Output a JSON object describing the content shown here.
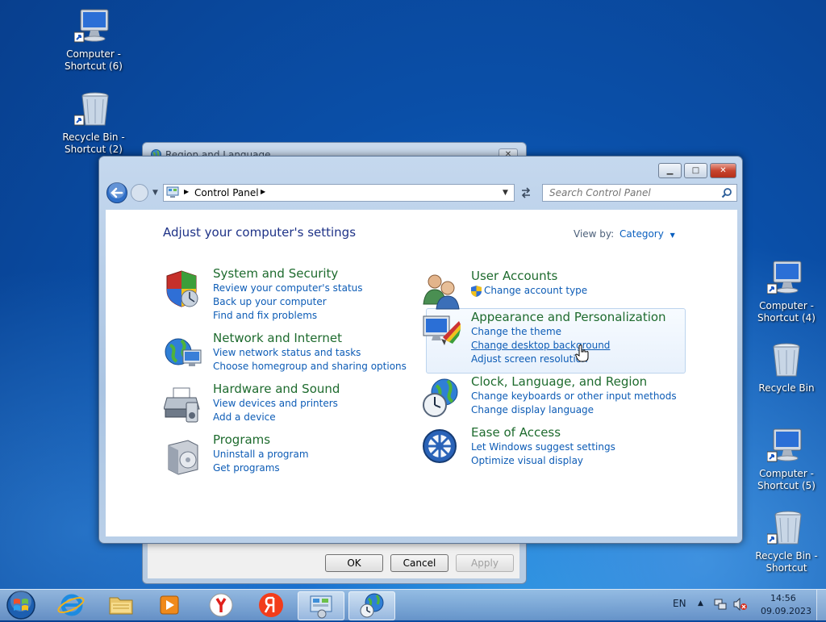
{
  "desktop": {
    "icons_left": [
      {
        "label_1": "Computer -",
        "label_2": "Shortcut (6)"
      },
      {
        "label_1": "Recycle Bin -",
        "label_2": "Shortcut (2)"
      }
    ],
    "icons_right": [
      {
        "label_1": "Computer -",
        "label_2": "Shortcut (4)"
      },
      {
        "label_1": "Recycle Bin",
        "label_2": ""
      },
      {
        "label_1": "Computer -",
        "label_2": "Shortcut (5)"
      },
      {
        "label_1": "Recycle Bin -",
        "label_2": "Shortcut"
      }
    ]
  },
  "bg_dialog": {
    "title": "Region and Language",
    "ok": "OK",
    "cancel": "Cancel",
    "apply": "Apply"
  },
  "window": {
    "breadcrumb": "Control Panel",
    "search_placeholder": "Search Control Panel",
    "heading": "Adjust your computer's settings",
    "view_by_label": "View by:",
    "view_by_value": "Category",
    "categories_left": [
      {
        "title": "System and Security",
        "links": [
          "Review your computer's status",
          "Back up your computer",
          "Find and fix problems"
        ]
      },
      {
        "title": "Network and Internet",
        "links": [
          "View network status and tasks",
          "Choose homegroup and sharing options"
        ]
      },
      {
        "title": "Hardware and Sound",
        "links": [
          "View devices and printers",
          "Add a device"
        ]
      },
      {
        "title": "Programs",
        "links": [
          "Uninstall a program",
          "Get programs"
        ]
      }
    ],
    "categories_right": [
      {
        "title": "User Accounts",
        "links": [
          "Change account type"
        ]
      },
      {
        "title": "Appearance and Personalization",
        "links": [
          "Change the theme",
          "Change desktop background",
          "Adjust screen resolution"
        ]
      },
      {
        "title": "Clock, Language, and Region",
        "links": [
          "Change keyboards or other input methods",
          "Change display language"
        ]
      },
      {
        "title": "Ease of Access",
        "links": [
          "Let Windows suggest settings",
          "Optimize visual display"
        ]
      }
    ]
  },
  "taskbar": {
    "language": "EN",
    "time": "14:56",
    "date": "09.09.2023"
  },
  "colors": {
    "link": "#0d5cb6",
    "category_title": "#1e6b2e",
    "heading": "#1e3287"
  }
}
